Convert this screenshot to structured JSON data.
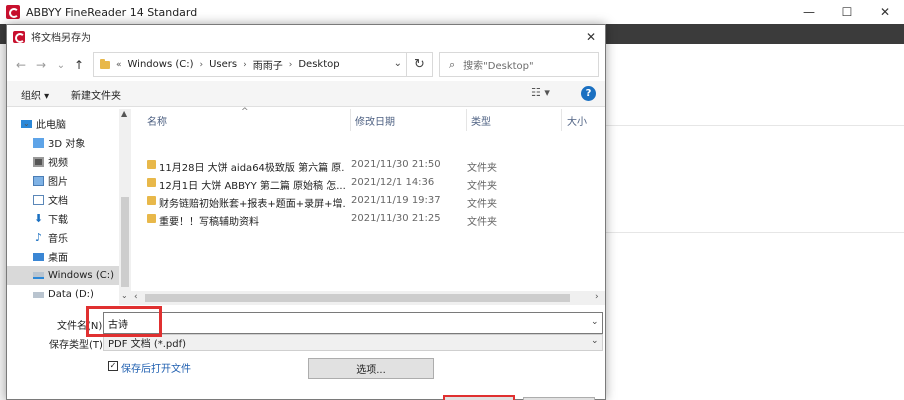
{
  "app": {
    "title": "ABBYY FineReader 14 Standard",
    "minimize_glyph": "—",
    "maximize_glyph": "☐",
    "close_glyph": "✕"
  },
  "dialog": {
    "title": "将文档另存为",
    "close_glyph": "✕"
  },
  "nav": {
    "back_glyph": "←",
    "forward_glyph": "→",
    "recent_glyph": "⌄",
    "up_glyph": "↑",
    "breadcrumb_prefix": "«",
    "breadcrumbs": [
      "Windows (C:)",
      "Users",
      "雨雨子",
      "Desktop"
    ],
    "breadcrumb_sep": "›",
    "dropdown_glyph": "⌄",
    "refresh_glyph": "↻",
    "search_placeholder": "搜索\"Desktop\"",
    "search_icon_glyph": "⌕"
  },
  "toolbar": {
    "organize_label": "组织 ▾",
    "new_folder_label": "新建文件夹",
    "view_glyph": "☷ ▾",
    "help_glyph": "?"
  },
  "navpane": {
    "items": [
      {
        "label": "此电脑",
        "icon": "computer-icon"
      },
      {
        "label": "3D 对象",
        "icon": "3d-objects-icon"
      },
      {
        "label": "视频",
        "icon": "video-icon"
      },
      {
        "label": "图片",
        "icon": "pictures-icon"
      },
      {
        "label": "文档",
        "icon": "documents-icon"
      },
      {
        "label": "下载",
        "icon": "download-icon"
      },
      {
        "label": "音乐",
        "icon": "music-icon"
      },
      {
        "label": "桌面",
        "icon": "desktop-icon"
      },
      {
        "label": "Windows (C:)",
        "icon": "drive-icon"
      },
      {
        "label": "Data (D:)",
        "icon": "drive-icon"
      }
    ],
    "scroll_up_glyph": "▲",
    "scroll_down_glyph": "⌄"
  },
  "filelist": {
    "columns": [
      "名称",
      "修改日期",
      "类型",
      "大小"
    ],
    "sort_glyph": "^",
    "rows": [
      {
        "name": "11月28日 大饼 aida64极致版 第六篇 原...",
        "date": "2021/11/30 21:50",
        "type": "文件夹"
      },
      {
        "name": "12月1日 大饼 ABBYY 第二篇 原始稿 怎...",
        "date": "2021/12/1 14:36",
        "type": "文件夹"
      },
      {
        "name": "财务链赔初始账套+报表+题面+录屏+增...",
        "date": "2021/11/19 19:37",
        "type": "文件夹"
      },
      {
        "name": "重要！！写稿辅助资料",
        "date": "2021/11/30 21:25",
        "type": "文件夹"
      }
    ],
    "scroll_left_glyph": "‹",
    "scroll_right_glyph": "›"
  },
  "form": {
    "filename_label": "文件名(N):",
    "filename_value": "古诗",
    "filetype_label": "保存类型(T):",
    "filetype_value": "PDF 文档 (*.pdf)",
    "dropdown_glyph": "⌄",
    "open_after_save_label": "保存后打开文件",
    "open_after_save_checked": "✓",
    "options_label": "选项..."
  },
  "colors": {
    "highlight": "#e03030",
    "accent": "#1b70c1",
    "brand": "#c8102e"
  }
}
